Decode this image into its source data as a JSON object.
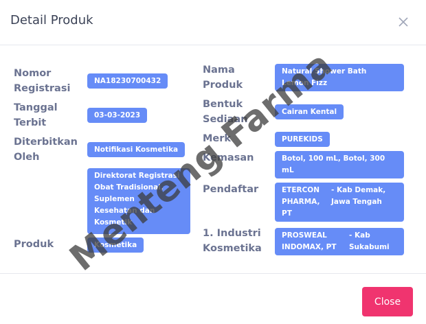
{
  "header": {
    "title": "Detail Produk"
  },
  "left": [
    {
      "label": "Nomor\nRegistrasi",
      "value": "NA18230700432"
    },
    {
      "label": "Tanggal\nTerbit",
      "value": "03-03-2023"
    },
    {
      "label": "Diterbitkan\nOleh",
      "value": "Notifikasi Kosmetika"
    },
    {
      "value": "Direktorat Registrasi\nObat Tradisional,\nSuplemen\nKesehatan dan\nKosmetik"
    },
    {
      "label": "Produk",
      "value": "Kosmetika"
    }
  ],
  "right": [
    {
      "label": "Nama\nProduk",
      "value": "Natural Shower Bath\nLemon Fizz"
    },
    {
      "label": "Bentuk\nSediaan",
      "value": "Cairan Kental"
    },
    {
      "label": "Merk",
      "value": "PUREKIDS"
    },
    {
      "label": "Kemasan",
      "value": "Botol, 100 mL, Botol, 300\nmL"
    },
    {
      "label": "Pendaftar",
      "value_name": "ETERCON\nPHARMA,\nPT",
      "value_location": "- Kab Demak,\nJawa Tengah"
    },
    {
      "label": "1. Industri\nKosmetika",
      "value_name": "PROSWEAL\nINDOMAX, PT",
      "value_location": "- Kab\nSukabumi"
    }
  ],
  "footer": {
    "close_label": "Close"
  },
  "watermark": "Menteng Farma",
  "colors": {
    "badge": "#668cf7",
    "close_button": "#f0346f",
    "label": "#6b7391"
  }
}
